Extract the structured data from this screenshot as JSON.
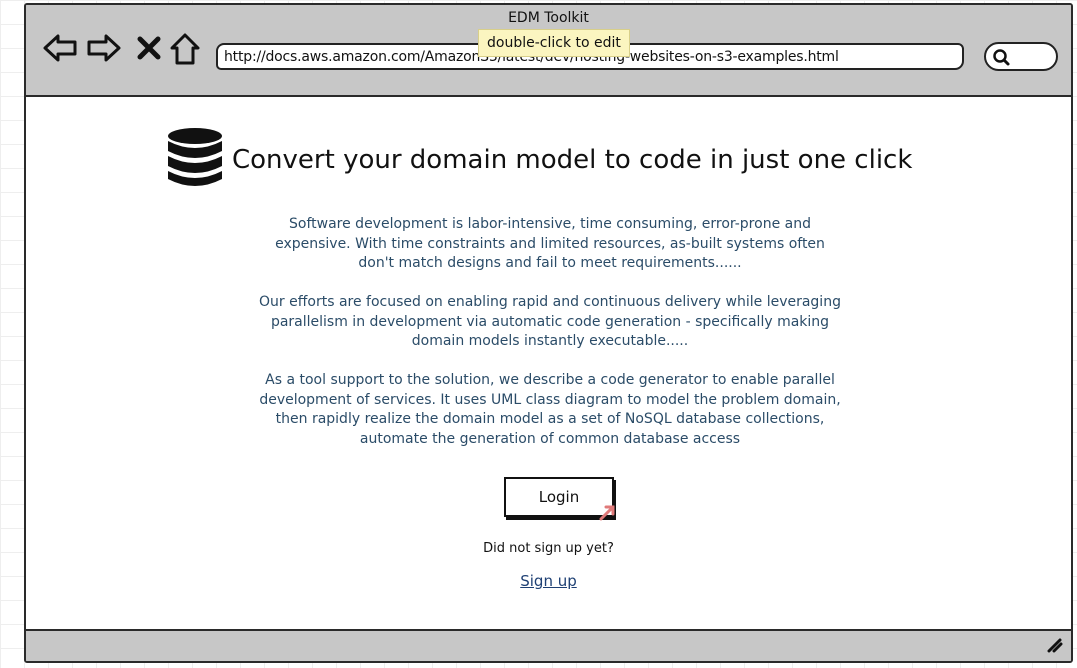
{
  "window": {
    "title": "EDM Toolkit"
  },
  "toolbar": {
    "back_icon": "arrow-left-icon",
    "forward_icon": "arrow-right-icon",
    "stop_icon": "close-icon",
    "home_icon": "home-icon",
    "url": "http://docs.aws.amazon.com/AmazonS3/latest/dev/hosting-websites-on-s3-examples.html",
    "search_icon": "search-icon"
  },
  "tooltip": {
    "text": "double-click to edit"
  },
  "main": {
    "logo_icon": "database-icon",
    "headline": "Convert your domain model to code in just one click",
    "paragraphs": [
      "Software development is labor-intensive, time consuming, error-prone and expensive. With time constraints and limited resources, as-built systems often don't match designs and fail to meet requirements......",
      "Our efforts are focused on enabling rapid and continuous delivery while leveraging parallelism in development via automatic code generation - specifically making domain models instantly executable.....",
      "As a tool support to the solution, we describe a code generator to enable parallel development of services. It uses UML class diagram to model the problem domain, then rapidly realize the domain model as a set of NoSQL database collections, automate the generation of common database access"
    ],
    "login_label": "Login",
    "signup_prompt": "Did not sign up yet?",
    "signup_link": "Sign up"
  },
  "colors": {
    "chrome": "#c7c7c7",
    "body_text": "#2b4c68",
    "link": "#1d3f73",
    "tooltip_bg": "#fbf5c0"
  }
}
